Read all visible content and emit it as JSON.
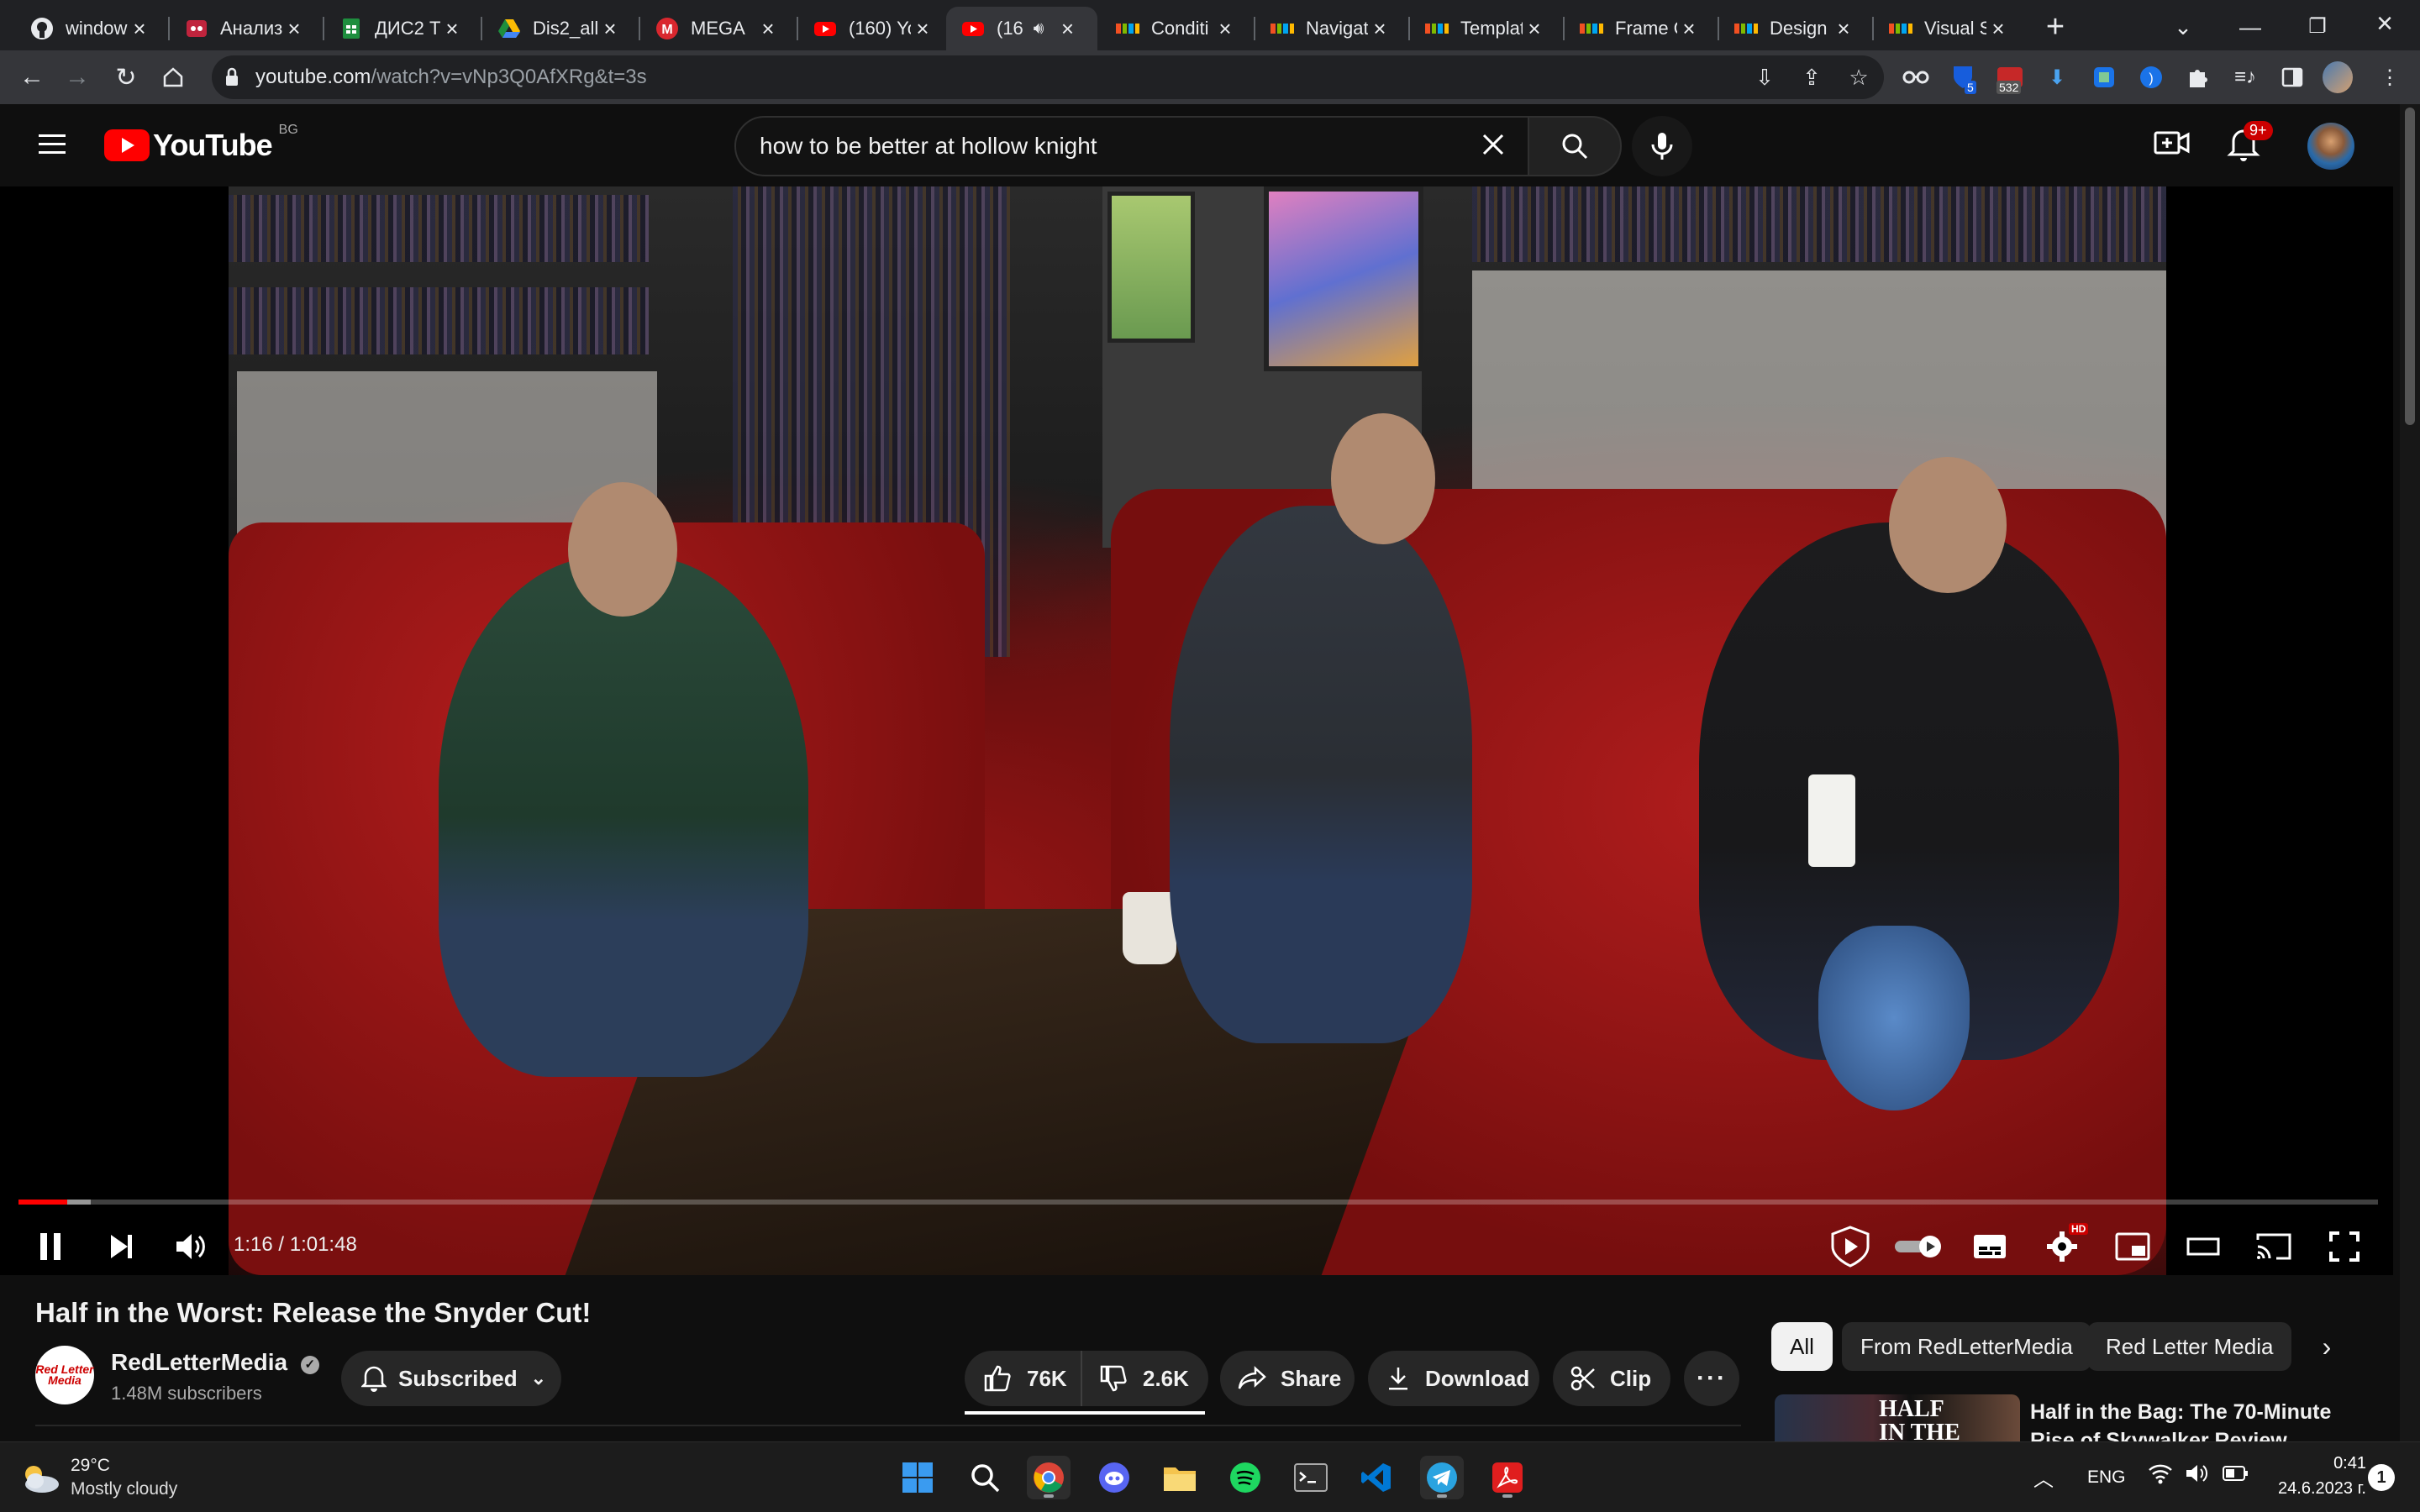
{
  "browser": {
    "tabs": [
      {
        "title": "window",
        "favicon": "github-icon",
        "active": false
      },
      {
        "title": "Анализ",
        "favicon": "app-red-icon",
        "active": false
      },
      {
        "title": "ДИС2 Т",
        "favicon": "sheets-icon",
        "active": false
      },
      {
        "title": "Dis2_all",
        "favicon": "drive-icon",
        "active": false
      },
      {
        "title": "MEGA",
        "favicon": "mega-icon",
        "active": false
      },
      {
        "title": "(160) Yo",
        "favicon": "youtube-icon",
        "active": false
      },
      {
        "title": "(16",
        "favicon": "youtube-icon",
        "active": true,
        "audio": true
      },
      {
        "title": "Conditi",
        "favicon": "microsoft-icon",
        "active": false
      },
      {
        "title": "Navigat",
        "favicon": "microsoft-icon",
        "active": false
      },
      {
        "title": "Templat",
        "favicon": "microsoft-icon",
        "active": false
      },
      {
        "title": "Frame C",
        "favicon": "microsoft-icon",
        "active": false
      },
      {
        "title": "Design",
        "favicon": "microsoft-icon",
        "active": false
      },
      {
        "title": "Visual S",
        "favicon": "microsoft-icon",
        "active": false
      }
    ],
    "url_host": "youtube.com",
    "url_path": "/watch?v=vNp3Q0AfXRg&t=3s",
    "ext_badge_1": "5",
    "ext_badge_2": "532"
  },
  "youtube": {
    "logo_text": "YouTube",
    "region": "BG",
    "search_query": "how to be better at hollow knight",
    "notifications_badge": "9+"
  },
  "player": {
    "current_time": "1:16",
    "duration": "1:01:48",
    "time_display": "1:16 / 1:01:48",
    "played_fraction": 0.0205,
    "buffered_fraction": 0.0305,
    "settings_badge": "HD"
  },
  "video": {
    "title": "Half in the Worst: Release the Snyder Cut!",
    "channel": "RedLetterMedia",
    "avatar_text": "Red Letter Media",
    "subscribers": "1.48M subscribers",
    "subscribe_label": "Subscribed",
    "likes": "76K",
    "dislikes": "2.6K",
    "share_label": "Share",
    "download_label": "Download",
    "clip_label": "Clip"
  },
  "sidebar": {
    "chips": [
      "All",
      "From RedLetterMedia",
      "Red Letter Media"
    ],
    "first_title_line1": "Half in the Bag: The 70-Minute",
    "first_title_line2": "Rise of Skywalker Review",
    "first_thumb_text": "HALF IN THE BAG"
  },
  "taskbar": {
    "weather_temp": "29°C",
    "weather_desc": "Mostly cloudy",
    "lang": "ENG",
    "time": "0:41",
    "date": "24.6.2023 г."
  }
}
